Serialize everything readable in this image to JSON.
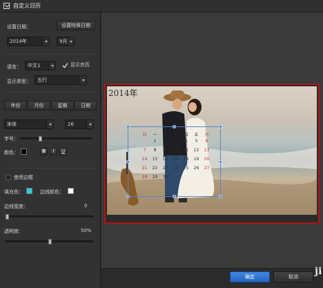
{
  "window": {
    "title": "自定义日历"
  },
  "settings": {
    "date_label": "设置日期：",
    "special_date_button": "设置特殊日期",
    "year_value": "2014年",
    "month_value": "9月",
    "language_label": "语言：",
    "language_value": "中文1",
    "show_lunar_label": "显示农历",
    "show_lunar_checked": true,
    "display_type_label": "显示类型：",
    "display_type_value": "五行"
  },
  "tabs": [
    "年份",
    "月份",
    "星期",
    "日期"
  ],
  "font": {
    "family_value": "宋体",
    "size_value": "26",
    "size_label": "字号：",
    "size_slider_fraction": 0.28,
    "color_label": "颜色：",
    "color": "#000000",
    "bold_label": "B",
    "italic_label": "I",
    "underline_label": "U"
  },
  "border": {
    "use_border_label": "使用边框",
    "fill_color_label": "填充色：",
    "fill_color": "#27d0e0",
    "border_color_label": "边线颜色：",
    "border_color": "#ffffff",
    "border_width_label": "边线宽度：",
    "border_width_value": "0",
    "border_width_fraction": 0.0,
    "opacity_label": "透明度：",
    "opacity_value": "50%",
    "opacity_fraction": 0.5
  },
  "preview": {
    "year_text": "2014年",
    "calendar": {
      "header": [
        "日",
        "一",
        "二",
        "三",
        "四",
        "五",
        "六"
      ],
      "rows": [
        [
          "",
          "1",
          "2",
          "3",
          "4",
          "5",
          "6"
        ],
        [
          "7",
          "8",
          "9",
          "10",
          "11",
          "12",
          "13"
        ],
        [
          "14",
          "15",
          "16",
          "17",
          "18",
          "19",
          "20"
        ],
        [
          "21",
          "22",
          "23",
          "24",
          "25",
          "26",
          "27"
        ],
        [
          "28",
          "29",
          "30",
          "",
          "",
          "",
          ""
        ]
      ]
    }
  },
  "footer": {
    "ok_label": "确定",
    "cancel_label": "取消",
    "watermark": "ji"
  },
  "colors": {
    "accent": "#2e74d4",
    "frame": "#b01515",
    "panel": "#323232"
  }
}
